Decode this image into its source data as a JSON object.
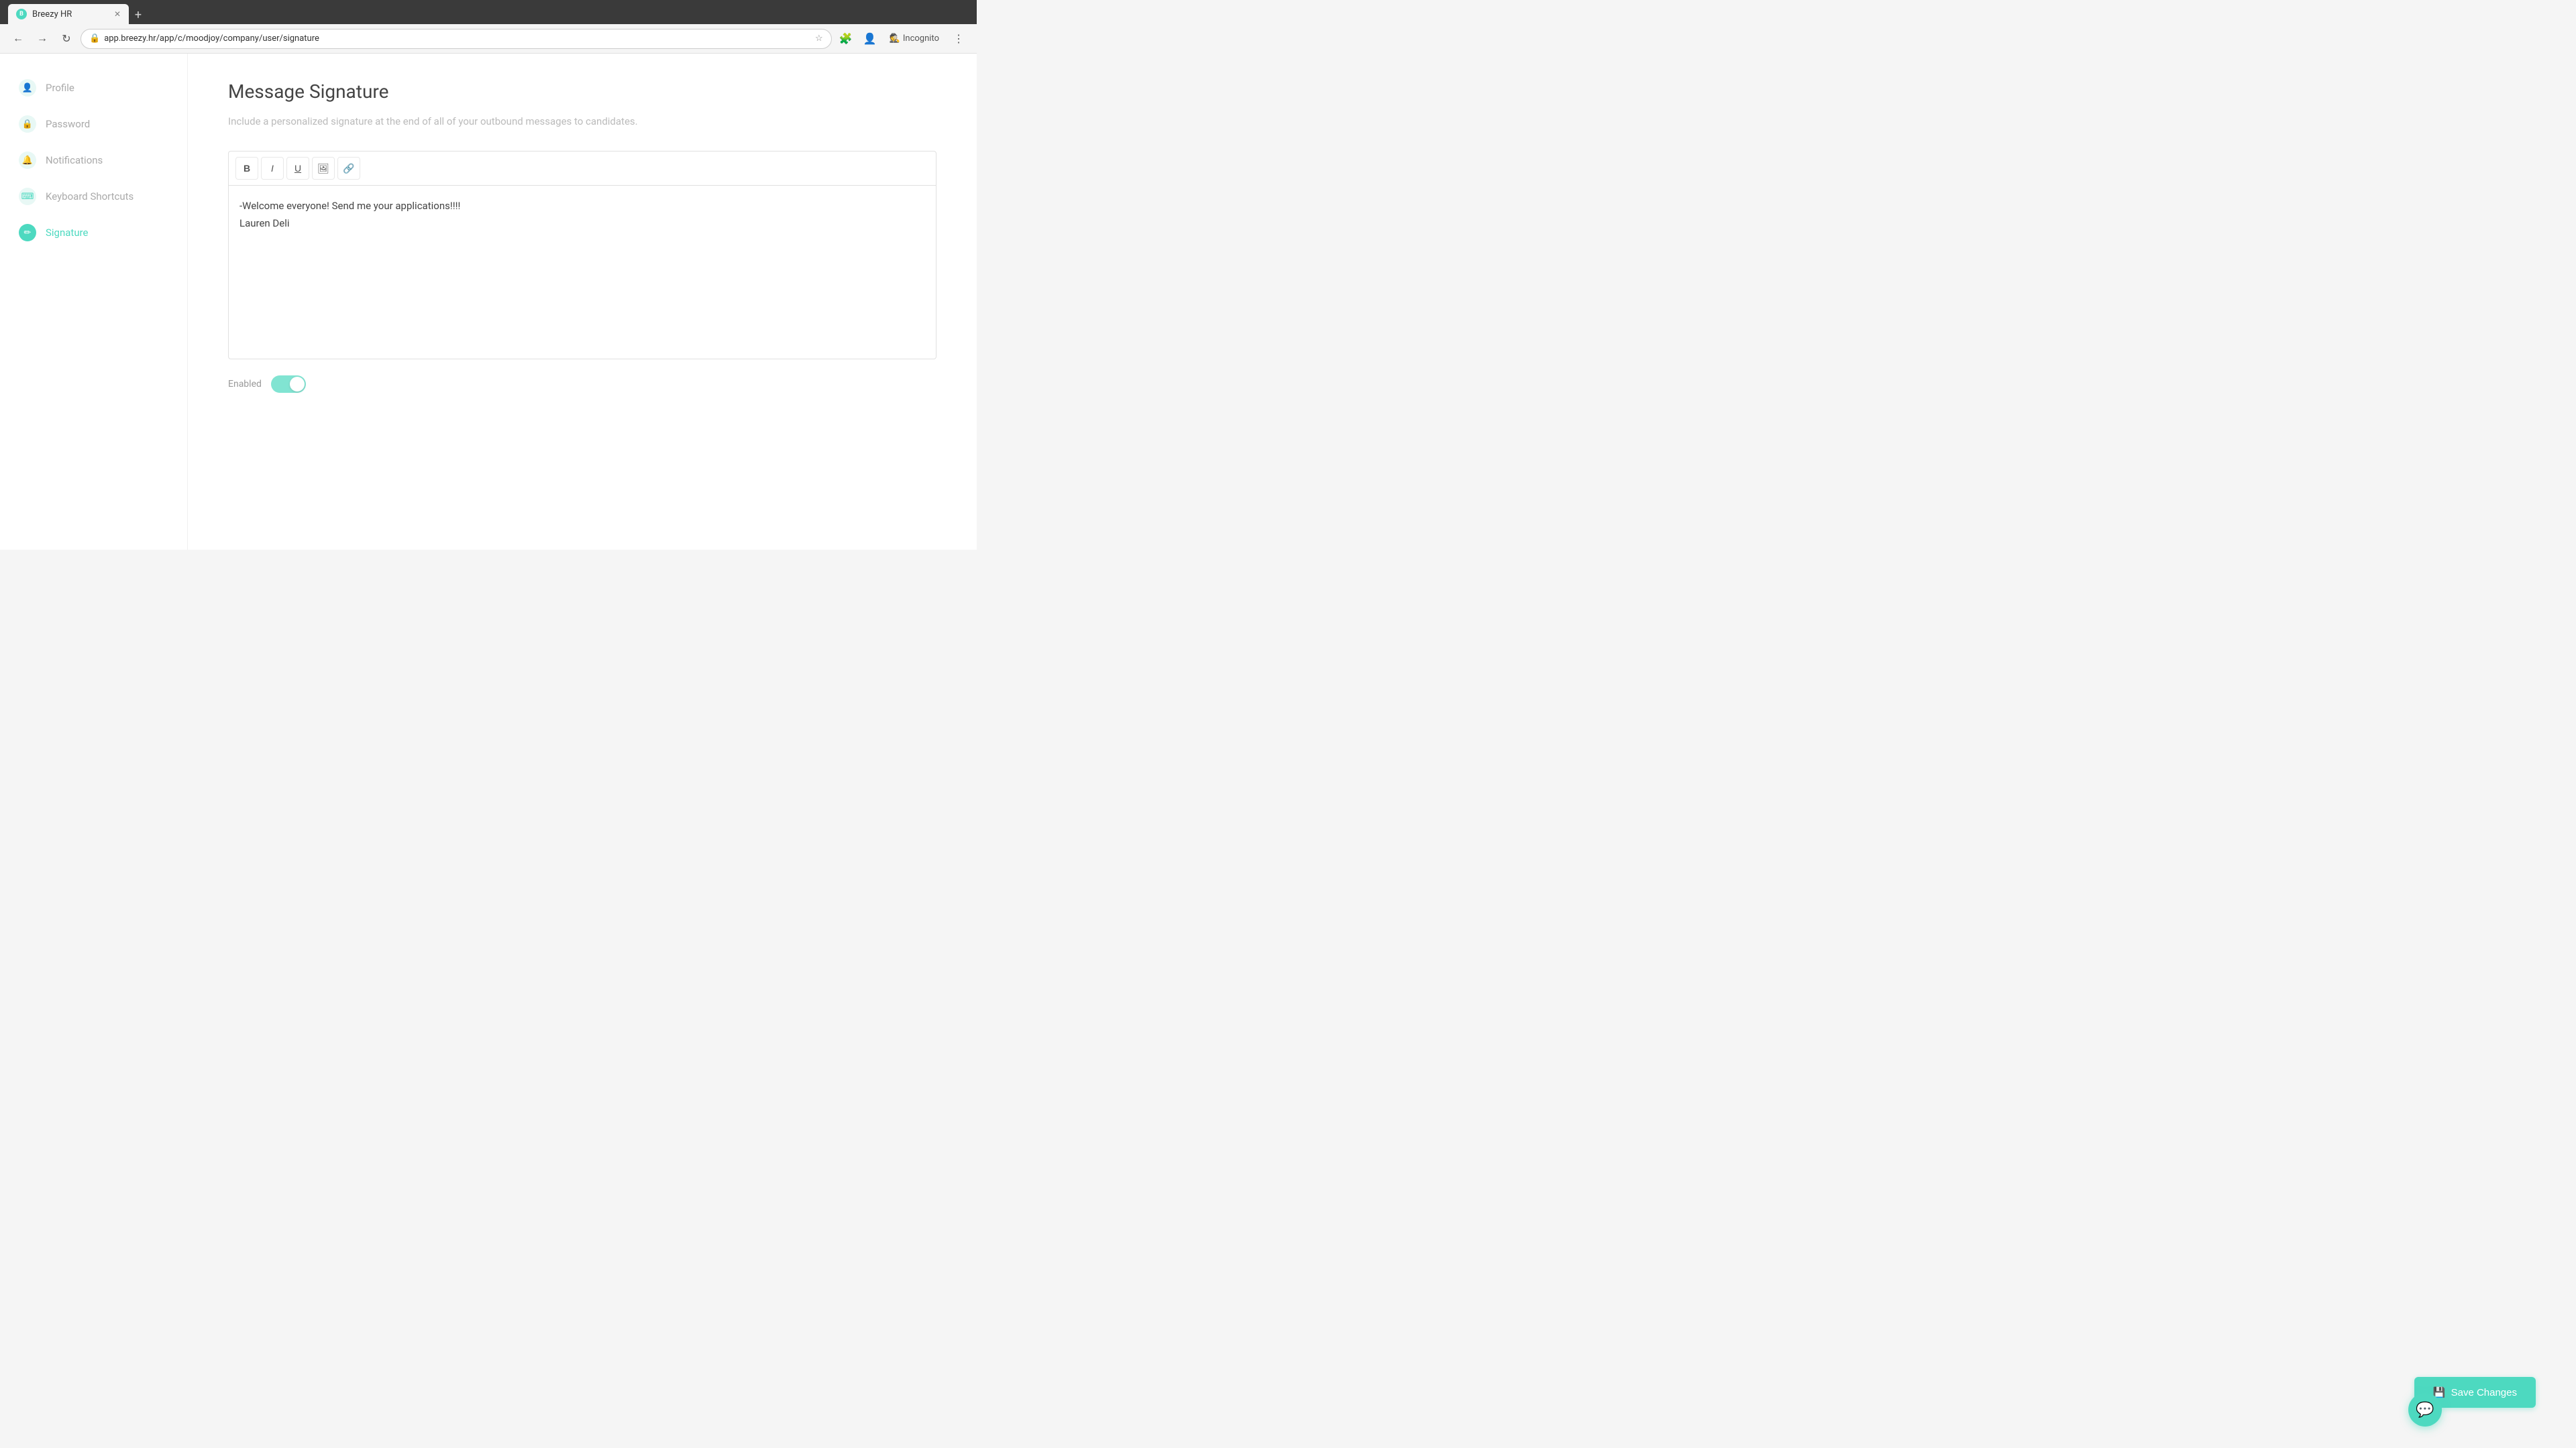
{
  "browser": {
    "tab_title": "Breezy HR",
    "url": "app.breezy.hr/app/c/moodjoy/company/user/signature",
    "incognito_label": "Incognito",
    "new_tab_label": "+"
  },
  "sidebar": {
    "items": [
      {
        "id": "profile",
        "label": "Profile",
        "icon": "👤",
        "active": false
      },
      {
        "id": "password",
        "label": "Password",
        "icon": "🔒",
        "active": false
      },
      {
        "id": "notifications",
        "label": "Notifications",
        "icon": "🔔",
        "active": false
      },
      {
        "id": "keyboard-shortcuts",
        "label": "Keyboard Shortcuts",
        "icon": "⌨",
        "active": false
      },
      {
        "id": "signature",
        "label": "Signature",
        "icon": "✏",
        "active": true
      }
    ]
  },
  "main": {
    "title": "Message Signature",
    "description": "Include a personalized signature at the end of all of your outbound messages to candidates.",
    "toolbar": {
      "bold_label": "B",
      "italic_label": "I",
      "underline_label": "U",
      "image_label": "🖼",
      "link_label": "🔗"
    },
    "signature_line1": "-Welcome everyone! Send me your applications!!!!",
    "signature_line2": "Lauren Deli",
    "toggle_label": "Enabled",
    "save_button_label": "Save Changes"
  },
  "chat": {
    "icon": "💬"
  }
}
